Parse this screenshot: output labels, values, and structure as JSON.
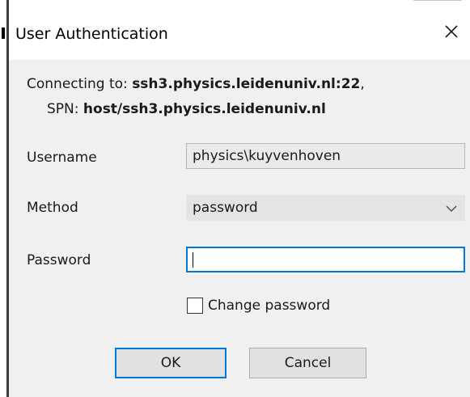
{
  "window": {
    "title": "User Authentication",
    "close_glyph": "close-icon"
  },
  "connection": {
    "connecting_label": "Connecting to:",
    "host": "ssh3.physics.leidenuniv.nl",
    "port": "22",
    "spn_label": "SPN:",
    "spn": "host/ssh3.physics.leidenuniv.nl"
  },
  "form": {
    "username_label": "Username",
    "username_value": "physics\\kuyvenhoven",
    "method_label": "Method",
    "method_value": "password",
    "password_label": "Password",
    "password_value": "",
    "change_password_label": "Change password",
    "change_password_checked": false
  },
  "buttons": {
    "ok": "OK",
    "cancel": "Cancel"
  },
  "colors": {
    "focus_accent": "#0078d7",
    "window_bg": "#f0f0f0",
    "titlebar_bg": "#ffffff"
  }
}
